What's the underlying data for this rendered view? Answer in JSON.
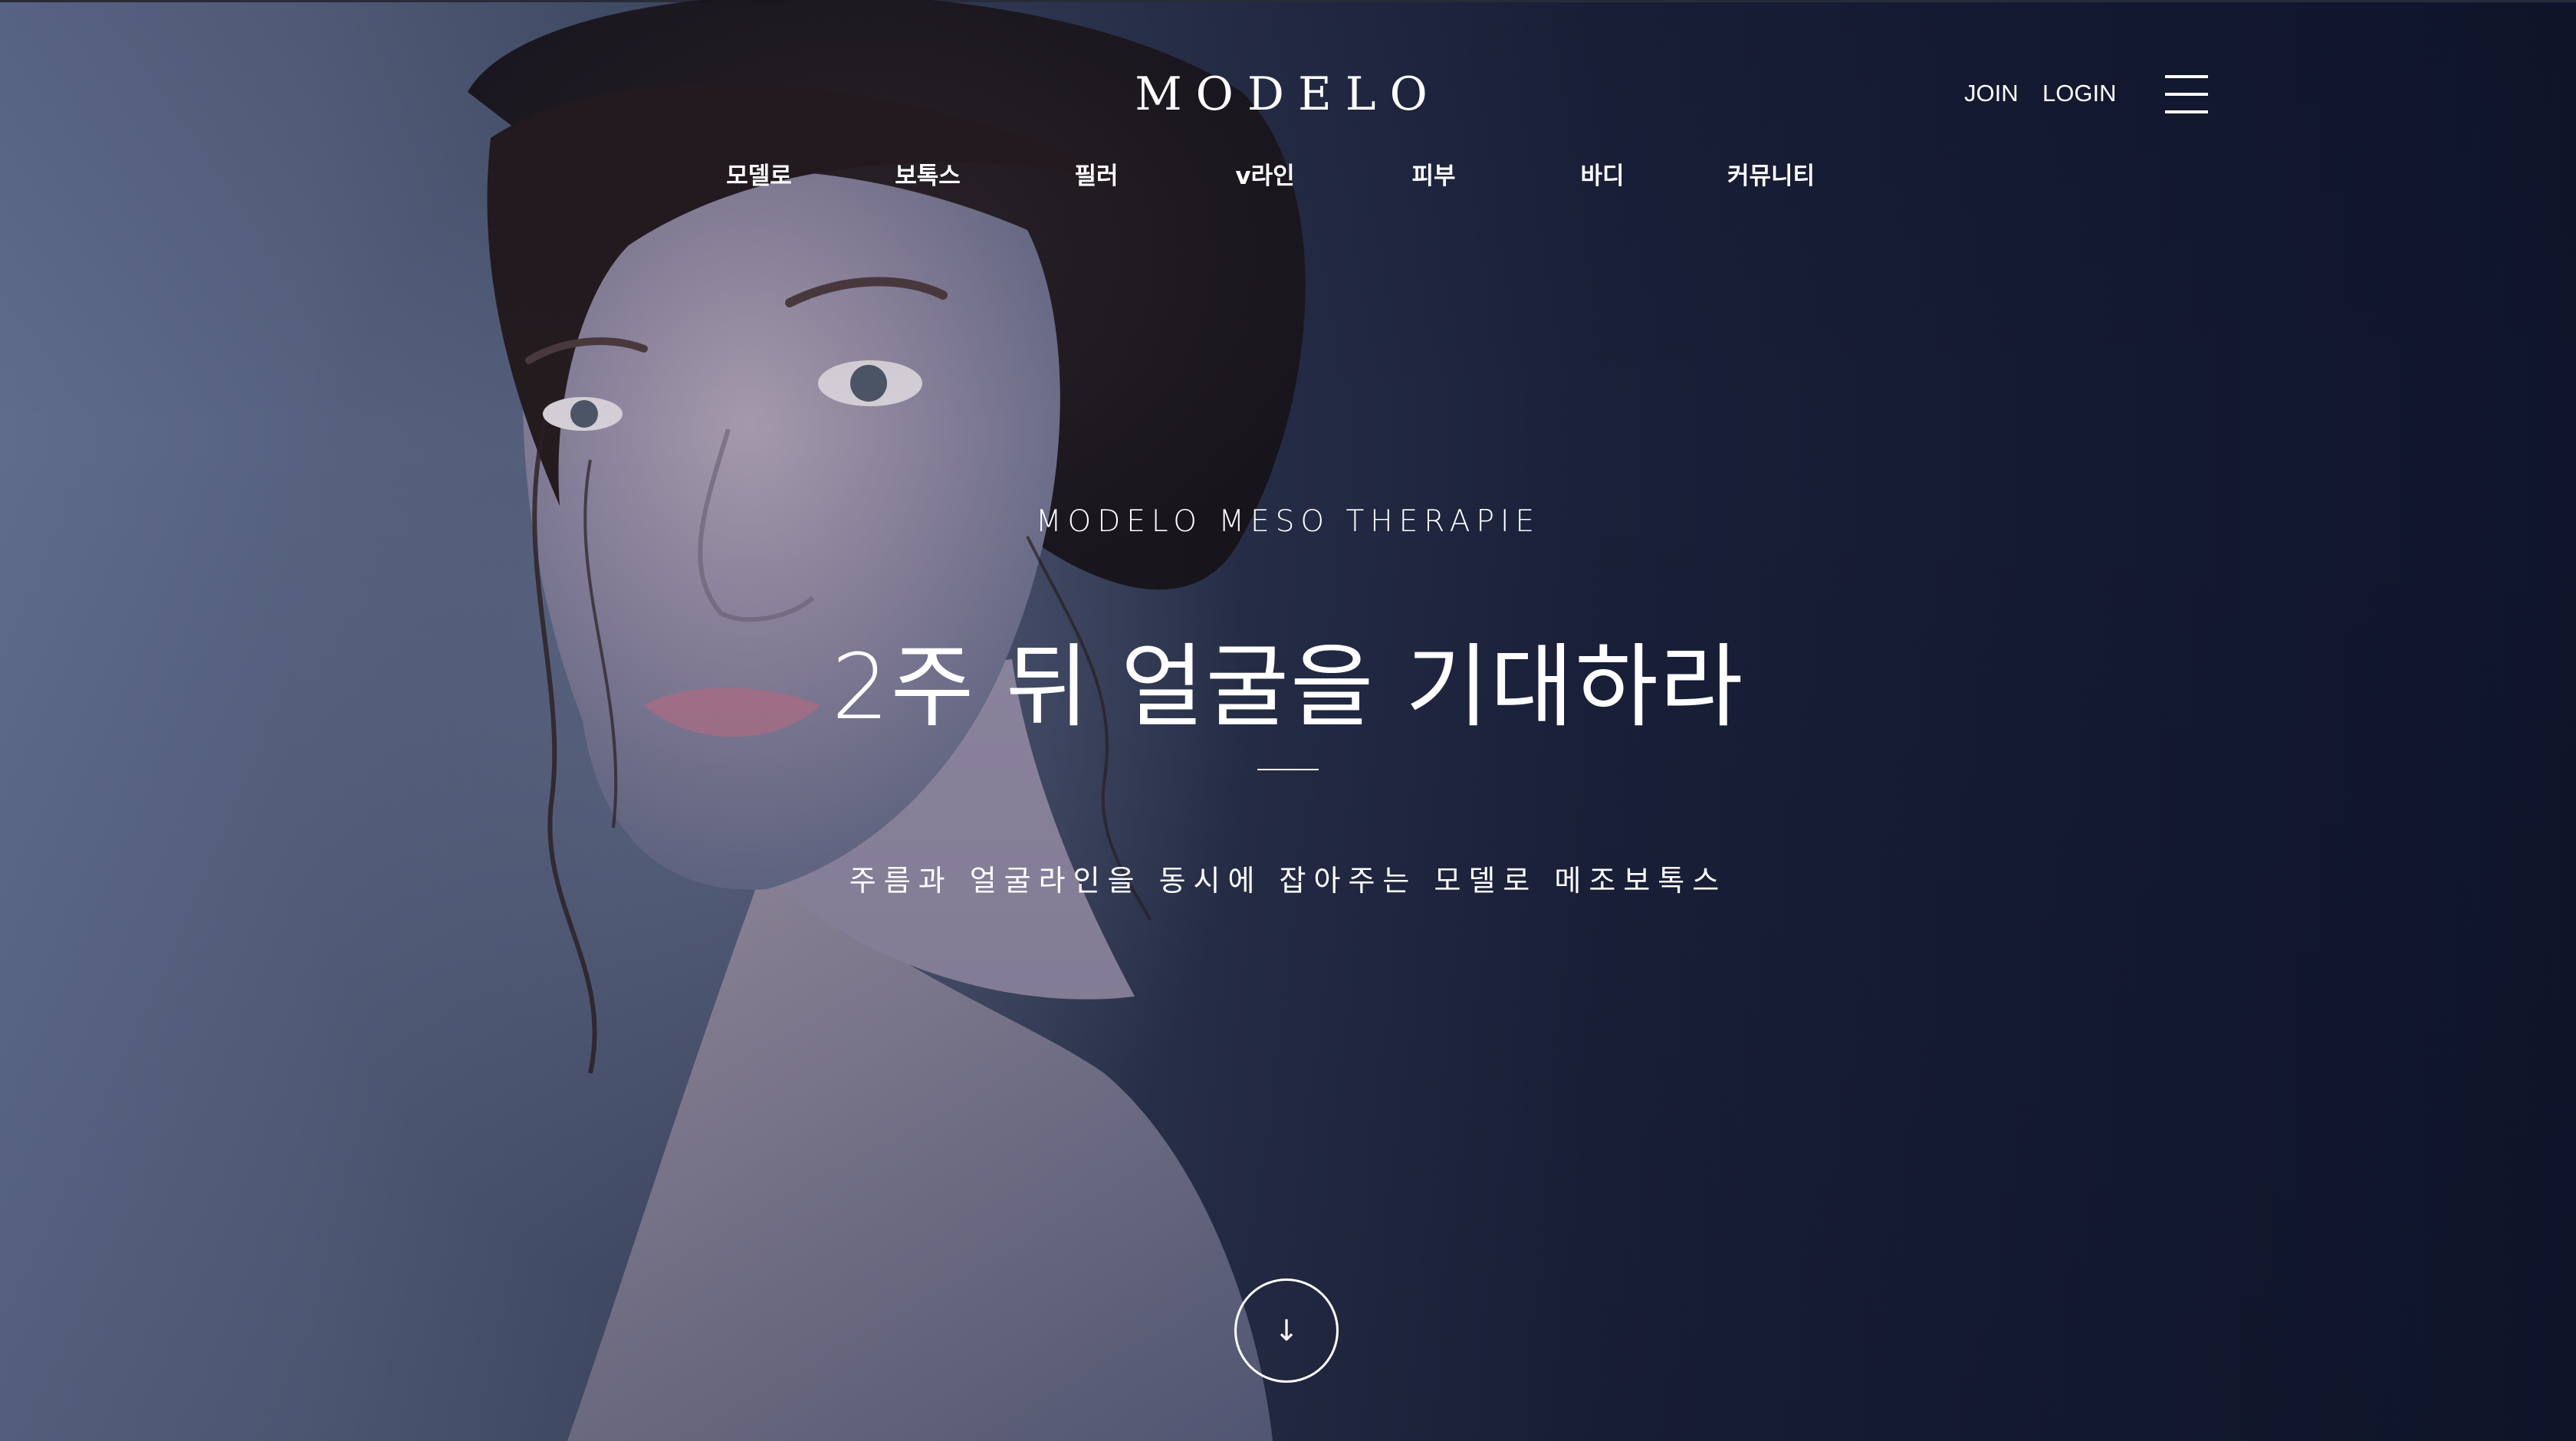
{
  "header": {
    "logo_text": "MODELO",
    "auth": {
      "join_label": "JOIN",
      "login_label": "LOGIN"
    },
    "menu_icon": "hamburger-menu-icon"
  },
  "nav": {
    "items": [
      {
        "label": "모델로"
      },
      {
        "label": "보톡스"
      },
      {
        "label": "필러"
      },
      {
        "label": "v라인"
      },
      {
        "label": "피부"
      },
      {
        "label": "바디"
      },
      {
        "label": "커뮤니티"
      }
    ]
  },
  "hero": {
    "eyebrow": "MODELO MESO THERAPIE",
    "headline": "2주 뒤 얼굴을 기대하라",
    "subcopy": "주름과 얼굴라인을 동시에 잡아주는 모델로 메조보톡스",
    "scroll_button": {
      "icon": "arrow-down-icon",
      "glyph": "↓"
    }
  },
  "colors": {
    "text": "#ffffff",
    "background_dark": "#141a31",
    "background_light": "#5f6c8c"
  }
}
